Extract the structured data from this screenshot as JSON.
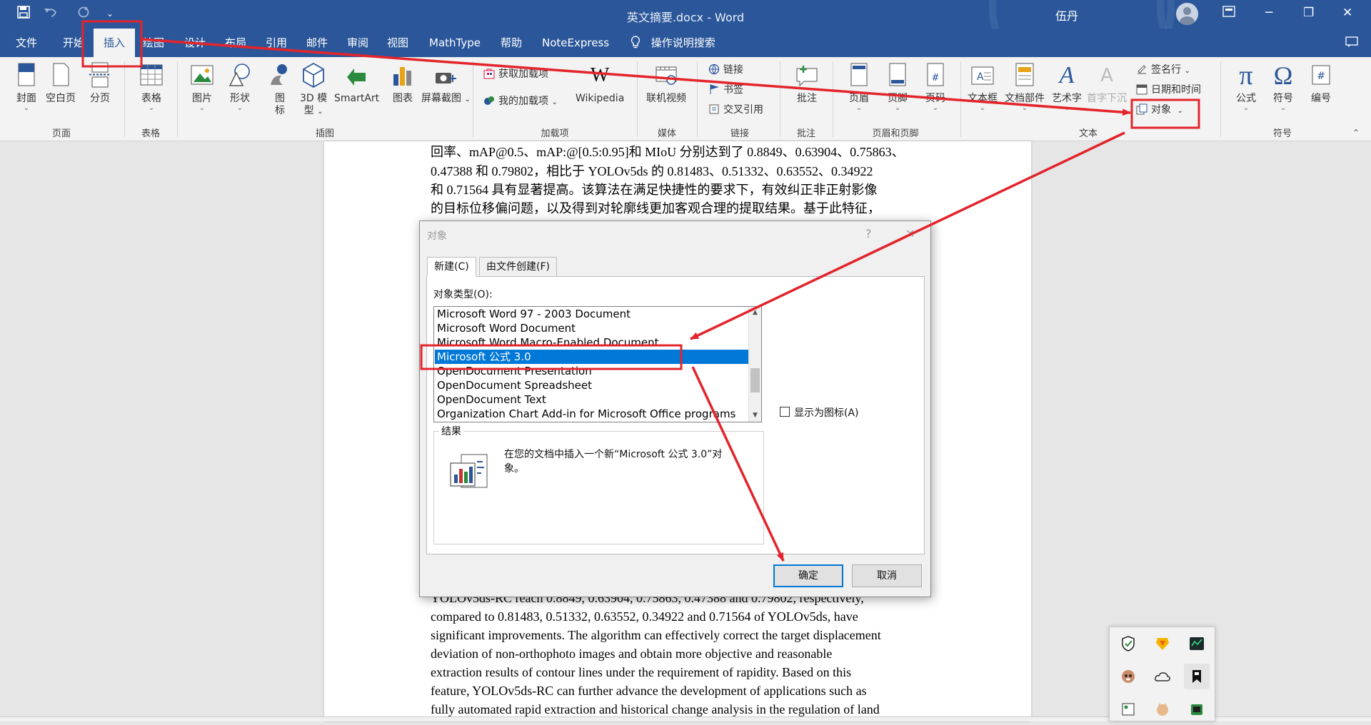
{
  "titlebar": {
    "quick_access": [
      "save-icon",
      "undo-icon",
      "redo-icon",
      "customize-icon"
    ],
    "document_title": "英文摘要.docx  -  Word",
    "user_name": "伍丹",
    "window_controls": [
      "ribbon-display-icon",
      "minimize-icon",
      "restore-icon",
      "close-icon"
    ]
  },
  "tabs": [
    {
      "label": "文件"
    },
    {
      "label": "开始"
    },
    {
      "label": "插入",
      "active": true
    },
    {
      "label": "绘图"
    },
    {
      "label": "设计"
    },
    {
      "label": "布局"
    },
    {
      "label": "引用"
    },
    {
      "label": "邮件"
    },
    {
      "label": "审阅"
    },
    {
      "label": "视图"
    },
    {
      "label": "MathType"
    },
    {
      "label": "帮助"
    },
    {
      "label": "NoteExpress"
    }
  ],
  "tell_me": {
    "icon": "lightbulb-icon",
    "label": "操作说明搜索"
  },
  "share_icon": "share-icon",
  "ribbon": {
    "groups": {
      "pages": {
        "label": "页面",
        "buttons": [
          {
            "label": "封面"
          },
          {
            "label": "空白页"
          },
          {
            "label": "分页"
          }
        ]
      },
      "tables": {
        "label": "表格",
        "buttons": [
          {
            "label": "表格"
          }
        ]
      },
      "illustrations": {
        "label": "插图",
        "buttons": [
          {
            "label": "图片"
          },
          {
            "label": "形状"
          },
          {
            "label": "图",
            "label2": "标"
          },
          {
            "label": "3D 模",
            "label2": "型"
          },
          {
            "label": "SmartArt"
          },
          {
            "label": "图表"
          },
          {
            "label": "屏幕截图"
          }
        ]
      },
      "addins": {
        "label": "加载项",
        "get": "获取加载项",
        "mine": "我的加载项",
        "wikipedia": "Wikipedia"
      },
      "media": {
        "label": "媒体",
        "buttons": [
          {
            "label": "联机视频"
          }
        ]
      },
      "links": {
        "label": "链接",
        "items": [
          {
            "label": "链接"
          },
          {
            "label": "书签"
          },
          {
            "label": "交叉引用"
          }
        ]
      },
      "comments": {
        "label": "批注",
        "buttons": [
          {
            "label": "批注"
          }
        ]
      },
      "header_footer": {
        "label": "页眉和页脚",
        "buttons": [
          {
            "label": "页眉"
          },
          {
            "label": "页脚"
          },
          {
            "label": "页码"
          }
        ]
      },
      "text": {
        "label": "文本",
        "buttons": [
          {
            "label": "文本框"
          },
          {
            "label": "文档部件"
          },
          {
            "label": "艺术字"
          },
          {
            "label": "首字下沉"
          }
        ],
        "small": [
          {
            "label": "签名行"
          },
          {
            "label": "日期和时间"
          },
          {
            "label": "对象"
          }
        ]
      },
      "symbols": {
        "label": "符号",
        "buttons": [
          {
            "label": "公式"
          },
          {
            "label": "符号"
          },
          {
            "label": "编号"
          }
        ]
      }
    }
  },
  "document": {
    "lines_top": [
      "回率、mAP@0.5、mAP:@[0.5:0.95]和 MIoU 分别达到了 0.8849、0.63904、0.75863、",
      "0.47388 和 0.79802，相比于 YOLOv5ds 的 0.81483、0.51332、0.63552、0.34922",
      "和 0.71564 具有显著提高。该算法在满足快捷性的要求下，有效纠正非正射影像",
      "的目标位移偏问题，以及得到对轮廓线更加客观合理的提取结果。基于此特征，"
    ],
    "lines_bottom": [
      "YOLOv5ds-RC reach 0.8849, 0.63904, 0.75863, 0.47388 and 0.79802, respectively,",
      "compared to 0.81483, 0.51332, 0.63552, 0.34922 and 0.71564 of YOLOv5ds, have",
      "significant improvements. The algorithm can effectively correct the target displacement",
      "deviation of non-orthophoto images and obtain more objective and reasonable",
      "extraction results of contour lines under the requirement of rapidity. Based on this",
      "feature, YOLOv5ds-RC can further advance the development of applications such as",
      "fully automated rapid extraction and historical change analysis in the regulation of land"
    ]
  },
  "dialog": {
    "title": "对象",
    "help": "?",
    "close": "✕",
    "tabs": [
      {
        "label": "新建(C)",
        "active": true
      },
      {
        "label": "由文件创建(F)"
      }
    ],
    "object_type_label": "对象类型(O):",
    "items": [
      {
        "label": "Microsoft Word 97 - 2003 Document"
      },
      {
        "label": "Microsoft Word Document"
      },
      {
        "label": "Microsoft Word Macro-Enabled Document"
      },
      {
        "label": "Microsoft 公式 3.0",
        "selected": true
      },
      {
        "label": "OpenDocument Presentation"
      },
      {
        "label": "OpenDocument Spreadsheet"
      },
      {
        "label": "OpenDocument Text"
      },
      {
        "label": "Organization Chart Add-in for Microsoft Office programs"
      }
    ],
    "display_as_icon": "显示为图标(A)",
    "result_label": "结果",
    "result_text": "在您的文档中插入一个新“Microsoft 公式 3.0”对象。",
    "ok": "确定",
    "cancel": "取消"
  },
  "tray": {
    "icons": [
      "security-shield-icon",
      "vpn-icon",
      "gpu-monitor-icon",
      "app-sloth-icon",
      "cloud-icon",
      "bookmark-app-icon",
      "app-icon-7",
      "app-icon-8",
      "app-icon-9"
    ]
  },
  "colors": {
    "accent": "#2b579a",
    "ribbon_bg": "#f3f3f3",
    "selection": "#0078d7",
    "annotation": "#e3242b"
  }
}
